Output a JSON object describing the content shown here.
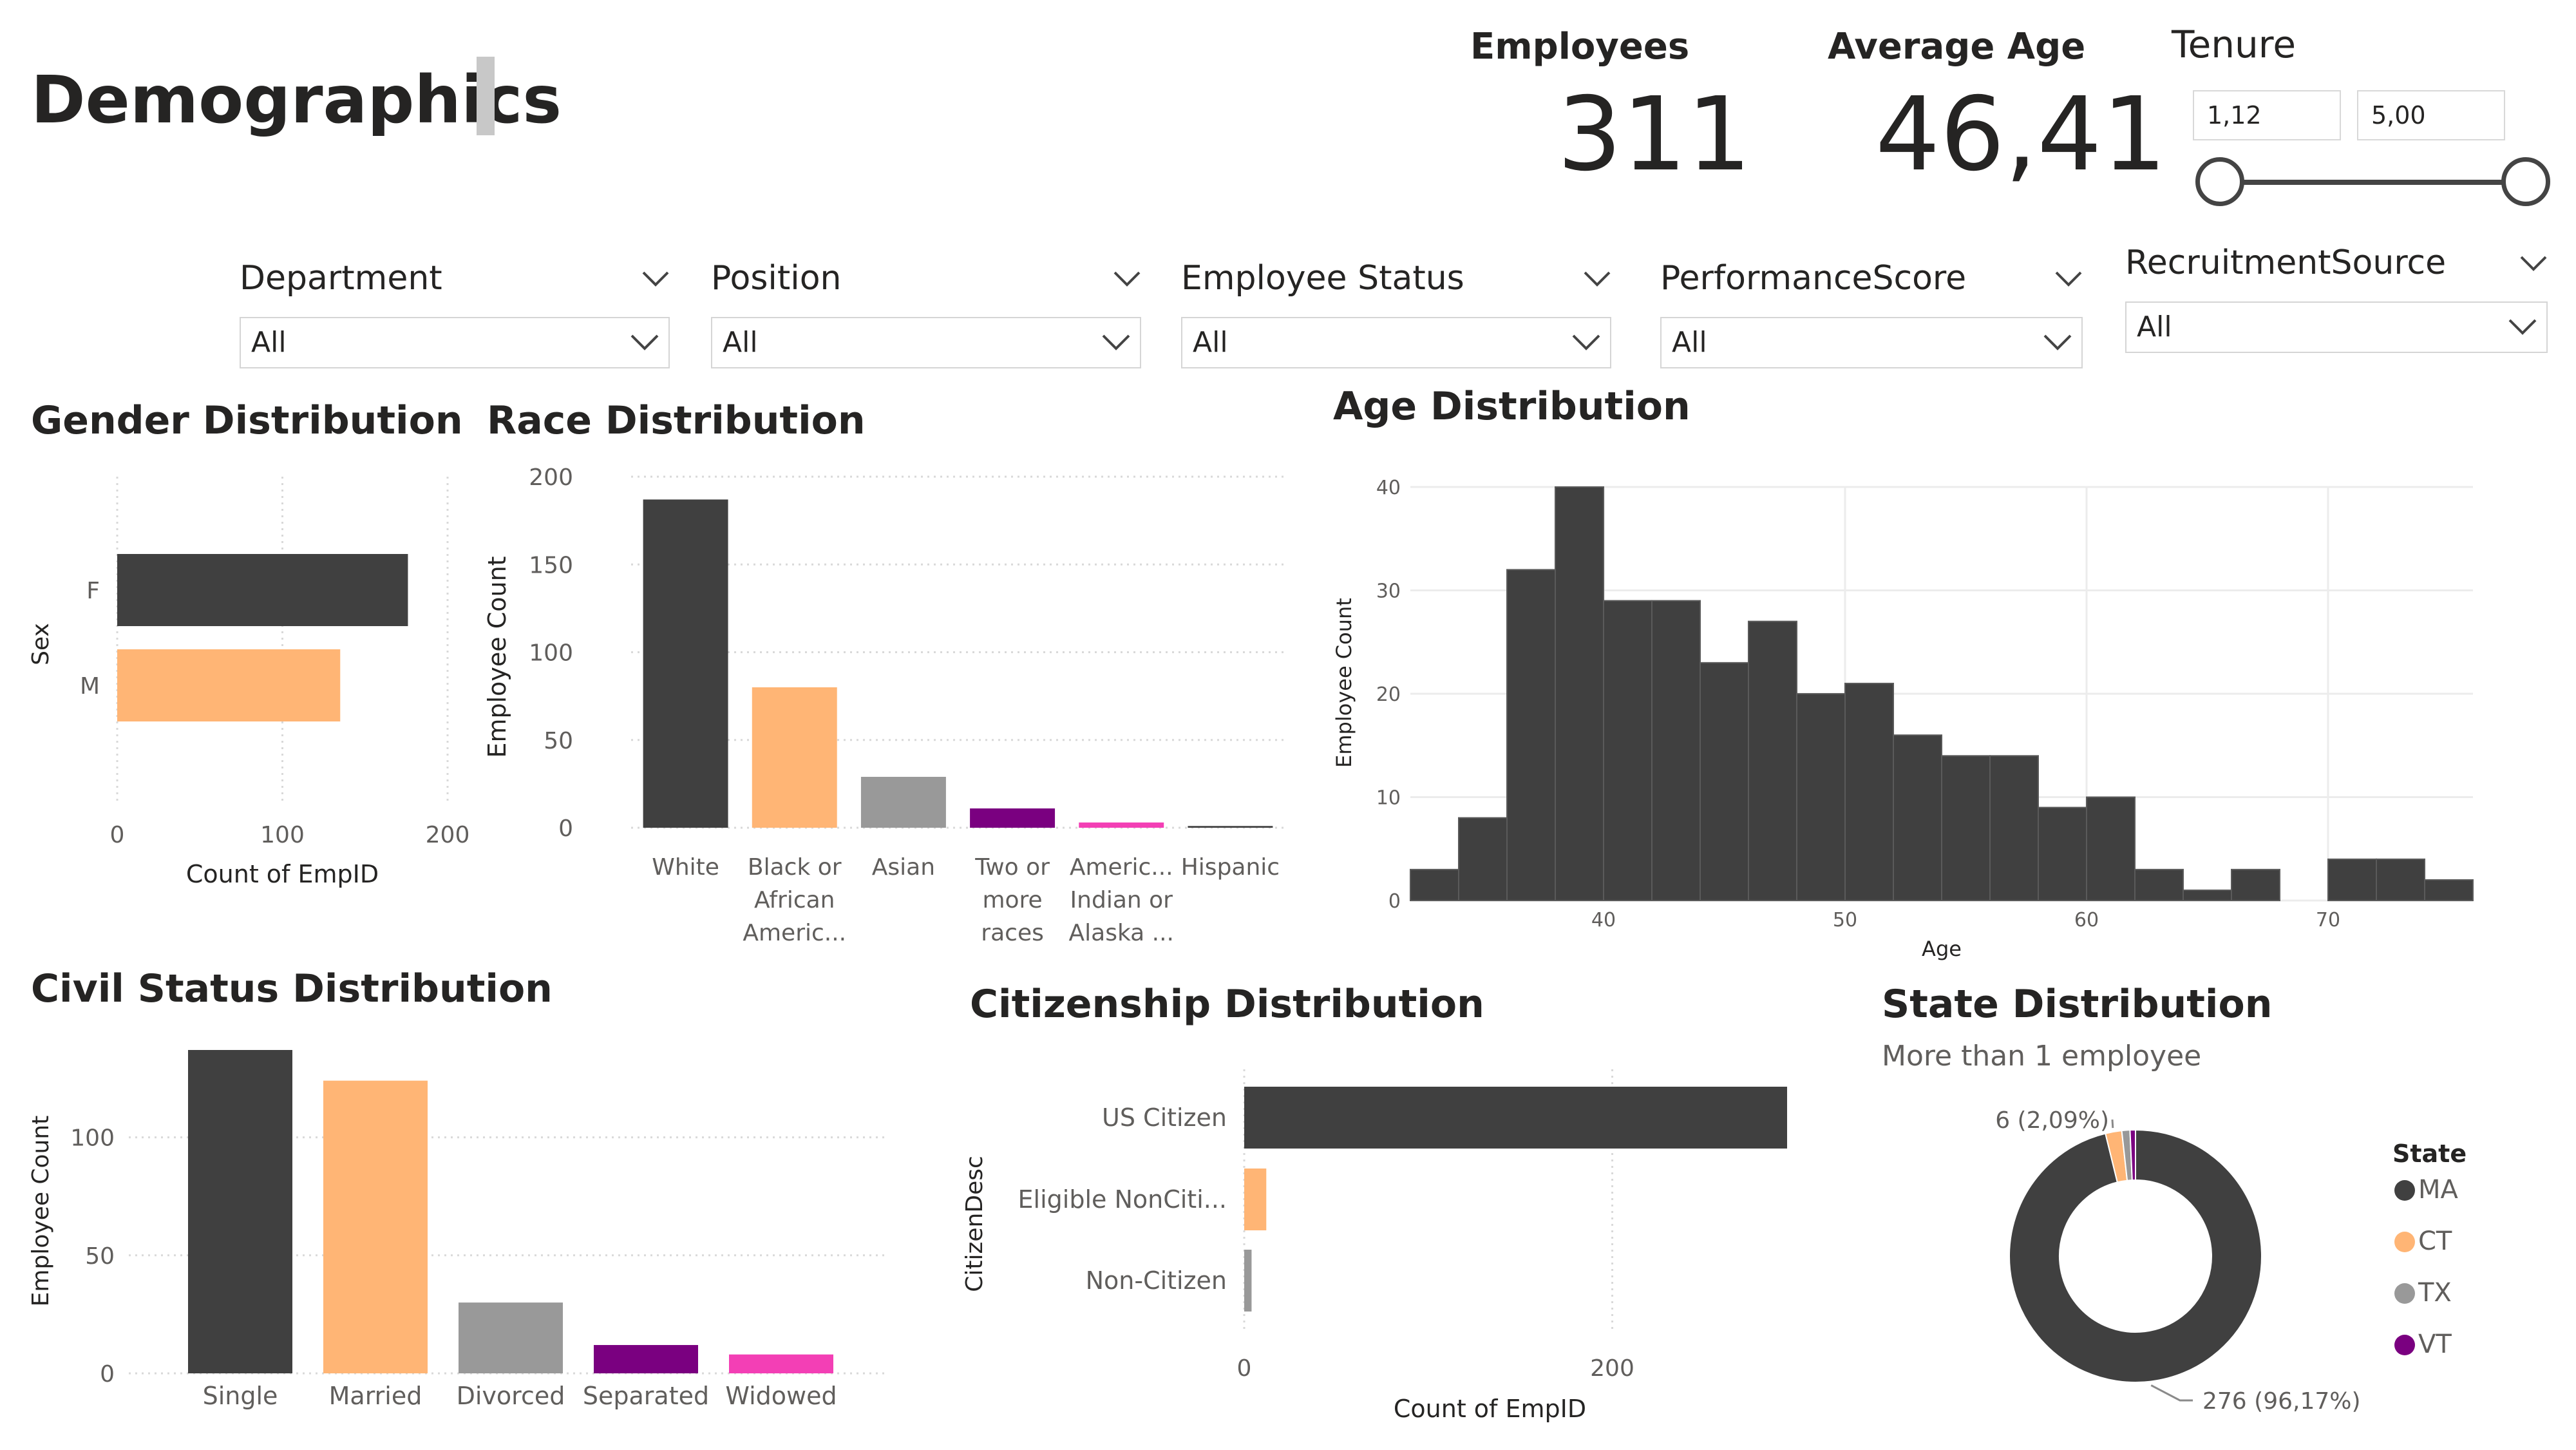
{
  "page": {
    "title": "Demographics"
  },
  "kpis": {
    "employees": {
      "label": "Employees",
      "value": "311"
    },
    "average_age": {
      "label": "Average Age",
      "value": "46,41"
    }
  },
  "tenure": {
    "label": "Tenure",
    "min": "1,12",
    "max": "5,00"
  },
  "filters": [
    {
      "header": "Department",
      "value": "All"
    },
    {
      "header": "Position",
      "value": "All"
    },
    {
      "header": "Employee Status",
      "value": "All"
    },
    {
      "header": "PerformanceScore",
      "value": "All"
    },
    {
      "header": "RecruitmentSource",
      "value": "All"
    }
  ],
  "colors": {
    "dark": "#404040",
    "orange": "#FFB575",
    "gray": "#999999",
    "purple": "#7A0080",
    "pink": "#F33FB5",
    "grid": "#d9d9d9"
  },
  "chart_data": [
    {
      "id": "gender",
      "type": "bar",
      "orientation": "horizontal",
      "title": "Gender Distribution",
      "xlabel": "Count of EmpID",
      "ylabel": "Sex",
      "categories": [
        "F",
        "M"
      ],
      "values": [
        176,
        135
      ],
      "colors": [
        "#404040",
        "#FFB575"
      ],
      "xlim": [
        0,
        200
      ],
      "xticks": [
        0,
        100,
        200
      ],
      "grid": true
    },
    {
      "id": "race",
      "type": "bar",
      "title": "Race Distribution",
      "xlabel": "",
      "ylabel": "Employee Count",
      "categories": [
        "White",
        "Black or African Americ...",
        "Asian",
        "Two or more races",
        "Americ... Indian or Alaska ...",
        "Hispanic"
      ],
      "category_lines": [
        [
          "White"
        ],
        [
          "Black or",
          "African",
          "Americ..."
        ],
        [
          "Asian"
        ],
        [
          "Two or",
          "more",
          "races"
        ],
        [
          "Americ...",
          "Indian or",
          "Alaska ..."
        ],
        [
          "Hispanic"
        ]
      ],
      "values": [
        187,
        80,
        29,
        11,
        3,
        1
      ],
      "colors": [
        "#404040",
        "#FFB575",
        "#999999",
        "#7A0080",
        "#F33FB5",
        "#404040"
      ],
      "ylim": [
        0,
        200
      ],
      "yticks": [
        0,
        50,
        100,
        150,
        200
      ],
      "grid": true
    },
    {
      "id": "age",
      "type": "bar",
      "subtype": "histogram",
      "title": "Age Distribution",
      "xlabel": "Age",
      "ylabel": "Employee Count",
      "bin_width": 2,
      "bins": [
        {
          "x0": 32,
          "count": 3
        },
        {
          "x0": 34,
          "count": 8
        },
        {
          "x0": 36,
          "count": 32
        },
        {
          "x0": 38,
          "count": 40
        },
        {
          "x0": 40,
          "count": 29
        },
        {
          "x0": 42,
          "count": 29
        },
        {
          "x0": 44,
          "count": 23
        },
        {
          "x0": 46,
          "count": 27
        },
        {
          "x0": 48,
          "count": 20
        },
        {
          "x0": 50,
          "count": 21
        },
        {
          "x0": 52,
          "count": 16
        },
        {
          "x0": 54,
          "count": 14
        },
        {
          "x0": 56,
          "count": 14
        },
        {
          "x0": 58,
          "count": 9
        },
        {
          "x0": 60,
          "count": 10
        },
        {
          "x0": 62,
          "count": 3
        },
        {
          "x0": 64,
          "count": 1
        },
        {
          "x0": 66,
          "count": 3
        },
        {
          "x0": 68,
          "count": 0
        },
        {
          "x0": 70,
          "count": 4
        },
        {
          "x0": 72,
          "count": 4
        },
        {
          "x0": 74,
          "count": 2
        }
      ],
      "xlim": [
        32,
        76
      ],
      "ylim": [
        0,
        40
      ],
      "xticks": [
        40,
        50,
        60,
        70
      ],
      "yticks": [
        0,
        10,
        20,
        30,
        40
      ],
      "grid": true
    },
    {
      "id": "civil",
      "type": "bar",
      "title": "Civil Status Distribution",
      "xlabel": "",
      "ylabel": "Employee Count",
      "categories": [
        "Single",
        "Married",
        "Divorced",
        "Separated",
        "Widowed"
      ],
      "values": [
        137,
        124,
        30,
        12,
        8
      ],
      "colors": [
        "#404040",
        "#FFB575",
        "#999999",
        "#7A0080",
        "#F33FB5"
      ],
      "ylim": [
        0,
        137
      ],
      "yticks": [
        0,
        50,
        100
      ],
      "grid": true
    },
    {
      "id": "citizenship",
      "type": "bar",
      "orientation": "horizontal",
      "title": "Citizenship Distribution",
      "xlabel": "Count of EmpID",
      "ylabel": "CitizenDesc",
      "categories": [
        "US Citizen",
        "Eligible NonCiti...",
        "Non-Citizen"
      ],
      "values": [
        295,
        12,
        4
      ],
      "colors": [
        "#404040",
        "#FFB575",
        "#999999"
      ],
      "xlim": [
        0,
        295
      ],
      "xticks": [
        0,
        200
      ],
      "grid": true
    },
    {
      "id": "state",
      "type": "pie",
      "subtype": "donut",
      "title": "State Distribution",
      "subtitle": "More than 1 employee",
      "legend_title": "State",
      "legend_position": "right",
      "labels": [
        "MA",
        "CT",
        "TX",
        "VT"
      ],
      "values": [
        276,
        6,
        3,
        2
      ],
      "colors": [
        "#404040",
        "#FFB575",
        "#999999",
        "#7A0080"
      ],
      "data_labels": [
        {
          "category": "MA",
          "text": "276 (96,17%)"
        },
        {
          "category": "CT",
          "text": "6 (2,09%)"
        }
      ]
    }
  ]
}
